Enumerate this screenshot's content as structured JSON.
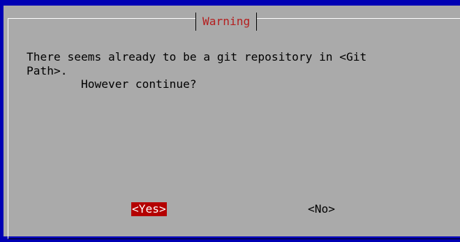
{
  "dialog": {
    "title": "Warning",
    "message_lines": [
      "There seems already to be a git repository in <Git",
      "Path>.",
      "        However continue?"
    ]
  },
  "buttons": {
    "yes": "<Yes>",
    "no": "<No>"
  },
  "colors": {
    "screen_background": "#0000b4",
    "dialog_background": "#aaaaaa",
    "title_text": "#b41e1e",
    "selected_button_bg": "#b40000",
    "selected_button_text": "#ffffff"
  }
}
